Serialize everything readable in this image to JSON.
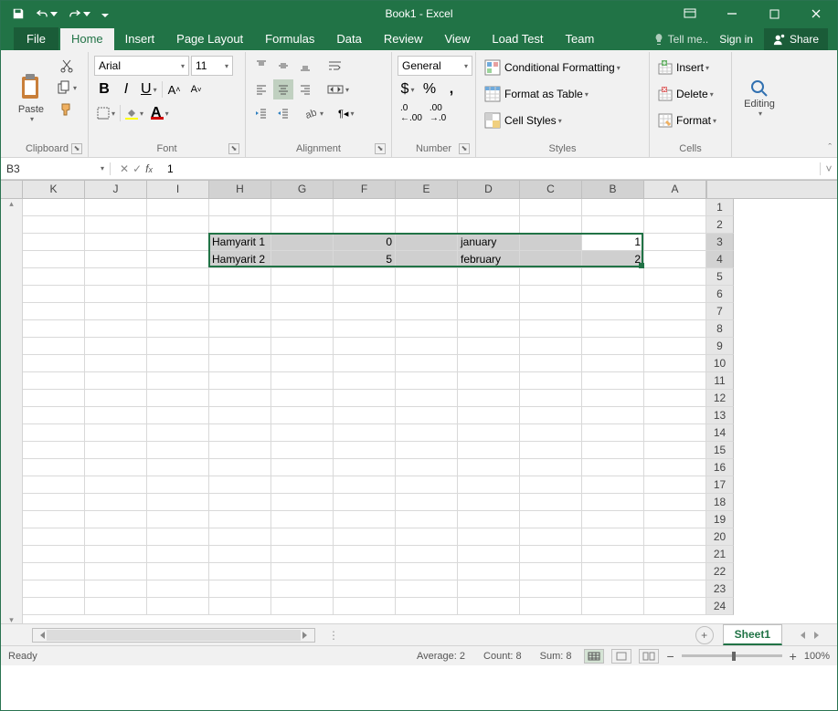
{
  "titlebar": {
    "title": "Book1 - Excel"
  },
  "tabs": {
    "file": "File",
    "home": "Home",
    "insert": "Insert",
    "pagelayout": "Page Layout",
    "formulas": "Formulas",
    "data": "Data",
    "review": "Review",
    "view": "View",
    "loadtest": "Load Test",
    "team": "Team",
    "tellme": "Tell me..",
    "signin": "Sign in",
    "share": "Share"
  },
  "ribbon": {
    "clipboard": {
      "paste": "Paste",
      "label": "Clipboard"
    },
    "font": {
      "name": "Arial",
      "size": "11",
      "label": "Font"
    },
    "alignment": {
      "label": "Alignment"
    },
    "number": {
      "format": "General",
      "label": "Number"
    },
    "styles": {
      "conditional": "Conditional Formatting",
      "formatTable": "Format as Table",
      "cellStyles": "Cell Styles",
      "label": "Styles"
    },
    "cells": {
      "insert": "Insert",
      "delete": "Delete",
      "format": "Format",
      "label": "Cells"
    },
    "editing": {
      "label": "Editing"
    }
  },
  "namebox": {
    "ref": "B3",
    "formula": "1"
  },
  "grid": {
    "columns": [
      "K",
      "J",
      "I",
      "H",
      "G",
      "F",
      "E",
      "D",
      "C",
      "B",
      "A"
    ],
    "rowcount": 24,
    "selected_rows": [
      3,
      4
    ],
    "active_cell": {
      "row": 3,
      "col": "B"
    },
    "cells": {
      "3": {
        "H": "Hamyarit 1",
        "F": "0",
        "D": "january",
        "B": "1"
      },
      "4": {
        "H": "Hamyarit 2",
        "F": "5",
        "D": "february",
        "B": "2"
      }
    }
  },
  "sheet": {
    "name": "Sheet1"
  },
  "status": {
    "ready": "Ready",
    "average": "Average: 2",
    "count": "Count: 8",
    "sum": "Sum: 8",
    "zoom": "100%"
  }
}
